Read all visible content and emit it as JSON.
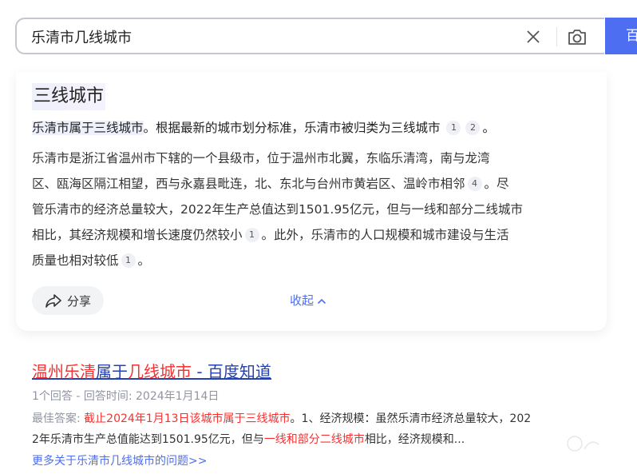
{
  "search": {
    "query": "乐清市几线城市",
    "button_label": "百度一下"
  },
  "answer": {
    "title": "三线城市",
    "summary_highlight": "乐清市属于三线城市",
    "summary_rest": "。根据最新的城市划分标准，乐清市被归类为三线城市",
    "summary_cites": [
      "1",
      "2"
    ],
    "summary_end": "。",
    "detail": {
      "l1": "乐清市是浙江省温州市下辖的一个县级市，位于温州市北翼，东临乐清湾，南与龙湾",
      "l2_a": "区、瓯海区隔江相望，西与永嘉县毗连，北、东北与台州市黄岩区、温岭市相邻",
      "l2_cite": "4",
      "l2_b": "。尽",
      "l3": "管乐清市的经济总量较大，2022年生产总值达到1501.95亿元，但与一线和部分二线城市",
      "l4_a": "相比，其经济规模和增长速度仍然较小",
      "l4_cite": "1",
      "l4_b": "。此外，乐清市的人口规模和城市建设与生活",
      "l5_a": "质量也相对较低",
      "l5_cite": "1",
      "l5_b": "。"
    },
    "share_label": "分享",
    "collapse_label": "收起"
  },
  "result": {
    "title_red1": "温州乐清",
    "title_plain1": "属于",
    "title_red2": "几线城市",
    "title_plain2": " - 百度知道",
    "meta": "1个回答 - 回答时间: 2024年1月14日",
    "snippet": {
      "label": "最佳答案: ",
      "red1": "截止2024年1月13日该城市属于三线城市",
      "text1": "。1、经济规模：虽然乐清市经济总量较大，202",
      "text2": "2年乐清市生产总值能达到1501.95亿元，但与",
      "red2": "一线和部分二线城市",
      "text3": "相比，经济规模和..."
    },
    "more_link": "更多关于乐清市几线城市的问题>>"
  },
  "colors": {
    "brand_blue": "#4e6ef2",
    "link_blue": "#2440b3",
    "highlight_red": "#f73131",
    "meta_gray": "#9195a3"
  },
  "icons": [
    "clear-icon",
    "camera-icon",
    "share-icon",
    "chevron-up-icon"
  ]
}
